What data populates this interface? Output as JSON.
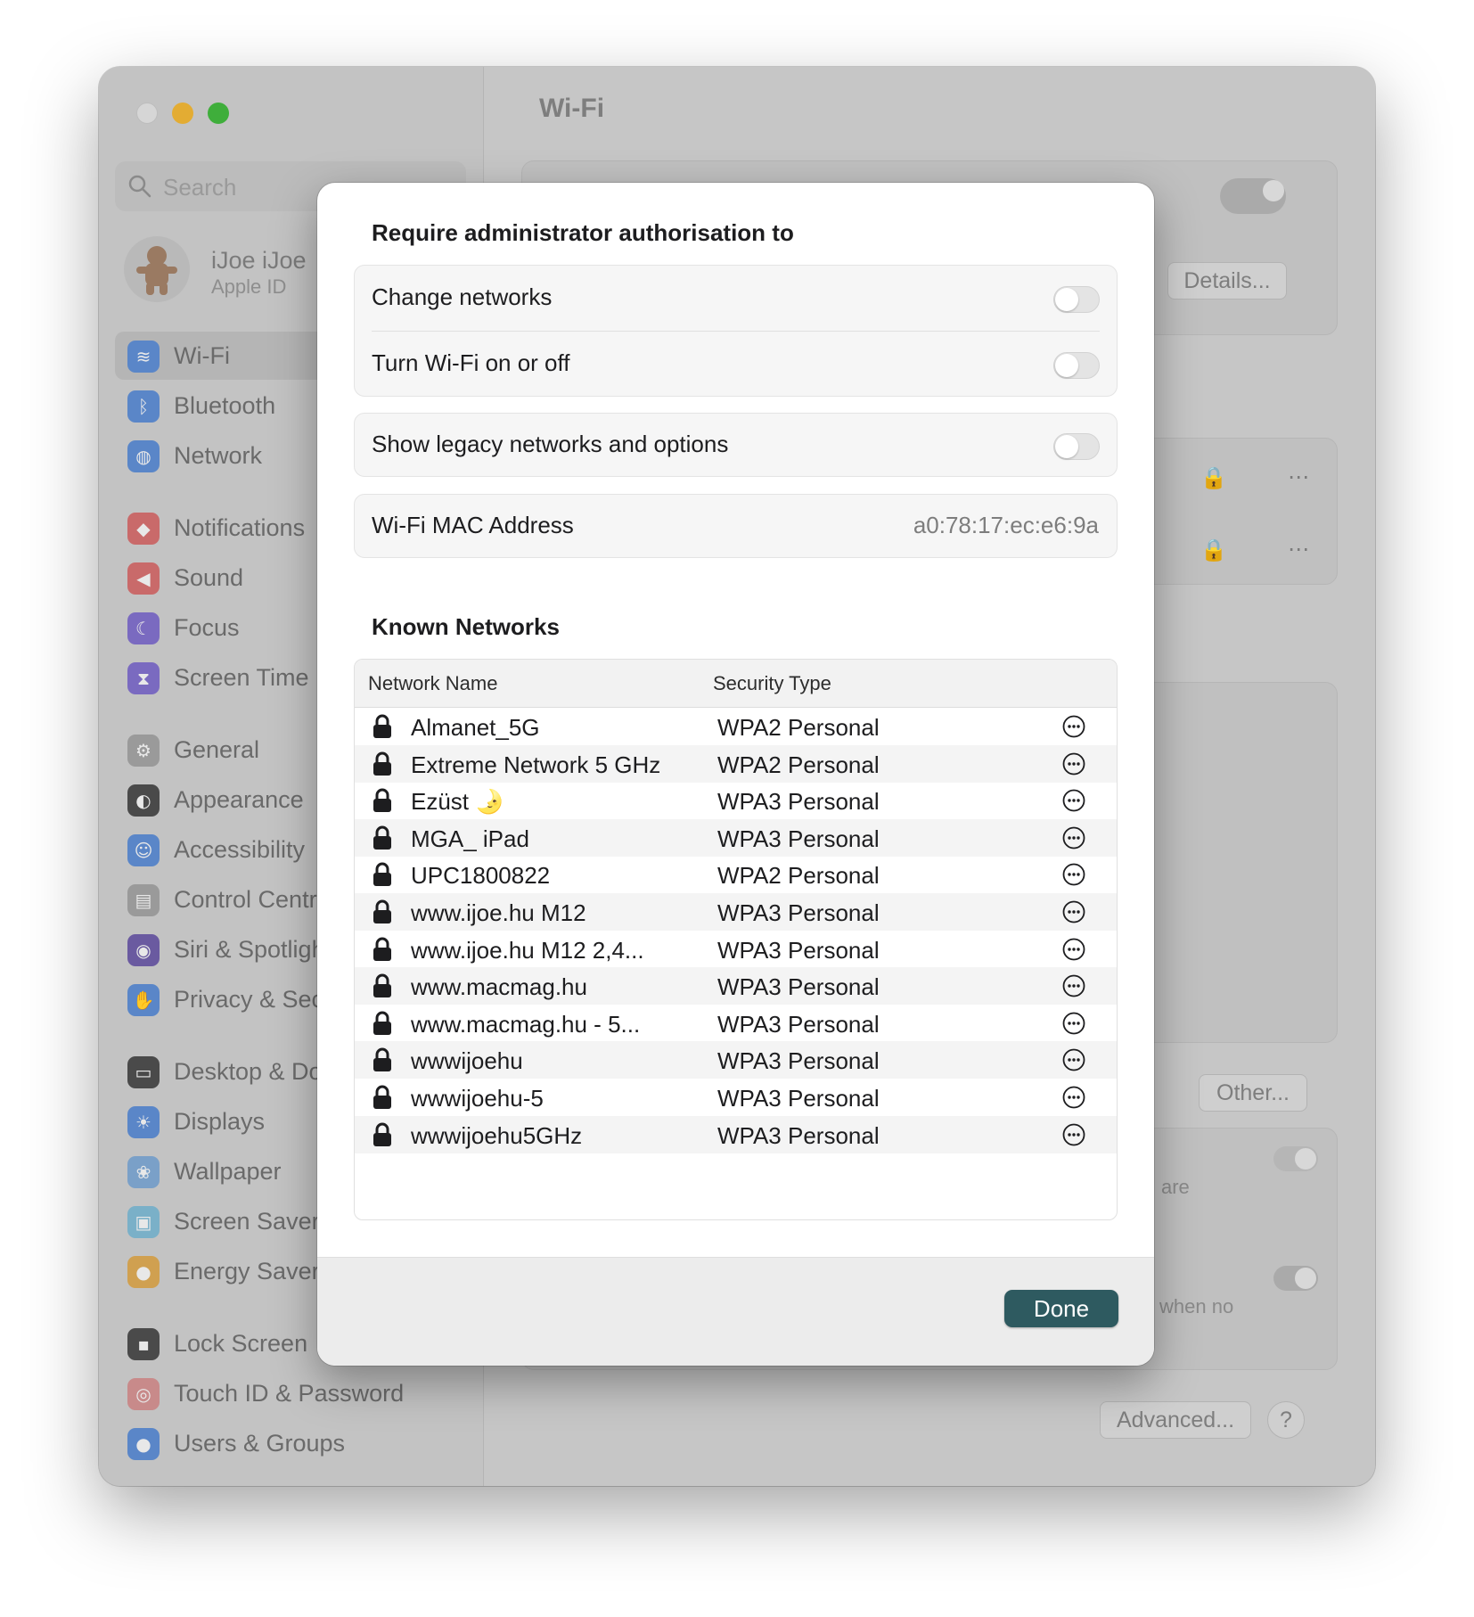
{
  "window": {
    "title": "Wi-Fi",
    "search_placeholder": "Search",
    "profile": {
      "name": "iJoe iJoe",
      "subtitle": "Apple ID"
    }
  },
  "sidebar": {
    "items": [
      {
        "label": "Wi-Fi",
        "icon": "wifi-icon",
        "color": "#5a86c8",
        "glyph": "≋"
      },
      {
        "label": "Bluetooth",
        "icon": "bluetooth-icon",
        "color": "#5a86c8",
        "glyph": "ᛒ"
      },
      {
        "label": "Network",
        "icon": "globe-icon",
        "color": "#5a86c8",
        "glyph": "◍"
      },
      {
        "label": "Notifications",
        "icon": "bell-icon",
        "color": "#c96a6a",
        "glyph": "◆"
      },
      {
        "label": "Sound",
        "icon": "speaker-icon",
        "color": "#c96a6a",
        "glyph": "◀"
      },
      {
        "label": "Focus",
        "icon": "moon-icon",
        "color": "#7a6ac0",
        "glyph": "☾"
      },
      {
        "label": "Screen Time",
        "icon": "hourglass-icon",
        "color": "#7a6ac0",
        "glyph": "⧗"
      },
      {
        "label": "General",
        "icon": "gear-icon",
        "color": "#9a9a9a",
        "glyph": "⚙"
      },
      {
        "label": "Appearance",
        "icon": "appearance-icon",
        "color": "#4a4a4a",
        "glyph": "◐"
      },
      {
        "label": "Accessibility",
        "icon": "accessibility-icon",
        "color": "#5a86c8",
        "glyph": "☺"
      },
      {
        "label": "Control Centre",
        "icon": "control-centre-icon",
        "color": "#9a9a9a",
        "glyph": "▤"
      },
      {
        "label": "Siri & Spotlight",
        "icon": "siri-icon",
        "color": "#6a5aa0",
        "glyph": "◉"
      },
      {
        "label": "Privacy & Security",
        "icon": "hand-icon",
        "color": "#5a86c8",
        "glyph": "✋"
      },
      {
        "label": "Desktop & Dock",
        "icon": "dock-icon",
        "color": "#4a4a4a",
        "glyph": "▭"
      },
      {
        "label": "Displays",
        "icon": "sun-icon",
        "color": "#5a86c8",
        "glyph": "☀"
      },
      {
        "label": "Wallpaper",
        "icon": "wallpaper-icon",
        "color": "#7aa0c8",
        "glyph": "❀"
      },
      {
        "label": "Screen Saver",
        "icon": "screen-saver-icon",
        "color": "#7ab0c8",
        "glyph": "▣"
      },
      {
        "label": "Energy Saver",
        "icon": "bulb-icon",
        "color": "#d0a050",
        "glyph": "●"
      },
      {
        "label": "Lock Screen",
        "icon": "lock-screen-icon",
        "color": "#4a4a4a",
        "glyph": "▪"
      },
      {
        "label": "Touch ID & Password",
        "icon": "fingerprint-icon",
        "color": "#c88a8a",
        "glyph": "◎"
      },
      {
        "label": "Users & Groups",
        "icon": "users-icon",
        "color": "#5a86c8",
        "glyph": "●"
      }
    ]
  },
  "background": {
    "details_button": "Details...",
    "other_button": "Other...",
    "advanced_button": "Advanced...",
    "help_button": "?",
    "snippet_1": "are",
    "snippet_2": "when no"
  },
  "modal": {
    "admin_title": "Require administrator authorisation to",
    "change_networks": {
      "label": "Change networks",
      "on": false
    },
    "turn_wifi": {
      "label": "Turn Wi-Fi on or off",
      "on": false
    },
    "legacy": {
      "label": "Show legacy networks and options",
      "on": false
    },
    "mac": {
      "label": "Wi-Fi MAC Address",
      "value": "a0:78:17:ec:e6:9a"
    },
    "known_title": "Known Networks",
    "columns": {
      "name": "Network Name",
      "security": "Security Type"
    },
    "networks": [
      {
        "name": "Almanet_5G",
        "security": "WPA2 Personal"
      },
      {
        "name": "Extreme Network 5 GHz",
        "security": "WPA2 Personal"
      },
      {
        "name": "Ezüst 🌛",
        "security": "WPA3 Personal"
      },
      {
        "name": "MGA_ iPad",
        "security": "WPA3 Personal"
      },
      {
        "name": "UPC1800822",
        "security": "WPA2 Personal"
      },
      {
        "name": "www.ijoe.hu M12",
        "security": "WPA3 Personal"
      },
      {
        "name": "www.ijoe.hu M12 2,4...",
        "security": "WPA3 Personal"
      },
      {
        "name": "www.macmag.hu",
        "security": "WPA3 Personal"
      },
      {
        "name": "www.macmag.hu - 5...",
        "security": "WPA3 Personal"
      },
      {
        "name": "wwwijoehu",
        "security": "WPA3 Personal"
      },
      {
        "name": "wwwijoehu-5",
        "security": "WPA3 Personal"
      },
      {
        "name": "wwwijoehu5GHz",
        "security": "WPA3 Personal"
      }
    ],
    "done_label": "Done"
  },
  "colors": {
    "accent": "#2e5a60",
    "window_bg": "#c6c6c6"
  }
}
